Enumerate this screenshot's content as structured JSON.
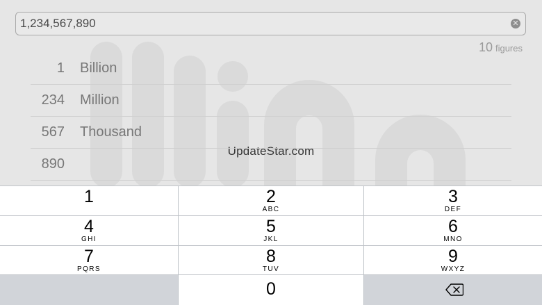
{
  "input": {
    "value": "1,234,567,890",
    "clear_icon": "clear-circle-icon"
  },
  "figures": {
    "count": "10",
    "unit": "figures"
  },
  "breakdown": [
    {
      "number": "1",
      "word": "Billion"
    },
    {
      "number": "234",
      "word": "Million"
    },
    {
      "number": "567",
      "word": "Thousand"
    },
    {
      "number": "890",
      "word": ""
    }
  ],
  "watermark": "UpdateStar.com",
  "keypad": {
    "keys": [
      {
        "digit": "1",
        "letters": ""
      },
      {
        "digit": "2",
        "letters": "ABC"
      },
      {
        "digit": "3",
        "letters": "DEF"
      },
      {
        "digit": "4",
        "letters": "GHI"
      },
      {
        "digit": "5",
        "letters": "JKL"
      },
      {
        "digit": "6",
        "letters": "MNO"
      },
      {
        "digit": "7",
        "letters": "PQRS"
      },
      {
        "digit": "8",
        "letters": "TUV"
      },
      {
        "digit": "9",
        "letters": "WXYZ"
      },
      {
        "digit": "0",
        "letters": ""
      }
    ],
    "backspace_icon": "backspace-icon"
  },
  "colors": {
    "background": "#e6e6e6",
    "key": "#ffffff",
    "key_dark": "#d1d4d9",
    "text_muted": "#777777"
  }
}
